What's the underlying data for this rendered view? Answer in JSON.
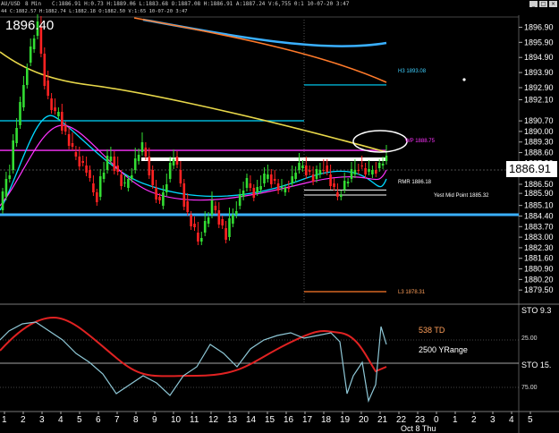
{
  "header": {
    "symbol": "AU/USD",
    "timeframe": "8 Min",
    "ohlc": "C:1886.91  H:0.73  H:1889.06  L:1883.68  O:1887.08  H:1886.91  A:1887.24  V:6,755  0:1  10-07-20  3:47",
    "subline": "44  C:1882.57  H:1882.74  L:1882.18  O:1882.50  V:1:65  10-07-20  3:47",
    "window_buttons": [
      "_",
      "□",
      "×"
    ]
  },
  "last_price_display": "1896.40",
  "current_price_tag": "1886.91",
  "price_axis": {
    "labels": [
      "1896.90",
      "1895.90",
      "1894.90",
      "1893.90",
      "1892.90",
      "1892.10",
      "1890.70",
      "1890.00",
      "1889.30",
      "1888.60",
      "1887.90",
      "1886.50",
      "1885.90",
      "1885.10",
      "1884.40",
      "1883.70",
      "1883.00",
      "1882.30",
      "1881.60",
      "1880.90",
      "1880.20",
      "1879.50"
    ],
    "values": [
      1896.9,
      1895.9,
      1894.9,
      1893.9,
      1892.9,
      1892.1,
      1890.7,
      1890.0,
      1889.3,
      1888.6,
      1887.9,
      1886.5,
      1885.9,
      1885.1,
      1884.4,
      1883.7,
      1883.0,
      1882.3,
      1881.6,
      1880.9,
      1880.2,
      1879.5
    ]
  },
  "level_labels": {
    "h3": "H3  1893.08",
    "wp": "WP  1888.75",
    "rmr": "RMR  1886.18",
    "ymp": "Yest Mid Point  1885.32",
    "l3": "L3  1878.31"
  },
  "indicator": {
    "label_td": "538 TD",
    "label_range": "2500 YRange",
    "sto_top": "STO  9.3",
    "sto_mid": "STO  15.",
    "scale_25": "25.00",
    "scale_75": "75.00",
    "td_color": "#ff9f5a",
    "range_color": "#ffffff"
  },
  "time_axis": {
    "labels": [
      "1",
      "2",
      "3",
      "4",
      "5",
      "6",
      "7",
      "8",
      "9",
      "10",
      "11",
      "12",
      "13",
      "14",
      "15",
      "16",
      "17",
      "18",
      "19",
      "20",
      "21",
      "22",
      "23",
      "0",
      "1",
      "2",
      "3",
      "4",
      "5"
    ],
    "date_label": "Oct 8 Thu"
  },
  "colors": {
    "background": "#000000",
    "up_candle": "#33dd33",
    "down_candle": "#ff2222",
    "cyan_line": "#00d8ff",
    "magenta_line": "#ff33ff",
    "yellow_ma": "#e8d84a",
    "orange_ma": "#ff7a2a",
    "blue_ma": "#3ab0ff",
    "white_level": "#ffffff"
  },
  "chart_data": {
    "type": "candlestick",
    "title": "",
    "x": [
      "1",
      "2",
      "3",
      "4",
      "5",
      "6",
      "7",
      "8",
      "9",
      "10",
      "11",
      "12",
      "13",
      "14",
      "15",
      "16",
      "17",
      "18",
      "19",
      "20",
      "21",
      "22",
      "23",
      "0",
      "1",
      "2",
      "3",
      "4",
      "5"
    ],
    "ylim": [
      1878.8,
      1897.4
    ],
    "levels": {
      "H3": 1893.08,
      "WP": 1888.75,
      "RMR": 1886.18,
      "Yest Mid Point": 1885.32,
      "L3": 1878.31
    },
    "last_price": 1886.91
  }
}
